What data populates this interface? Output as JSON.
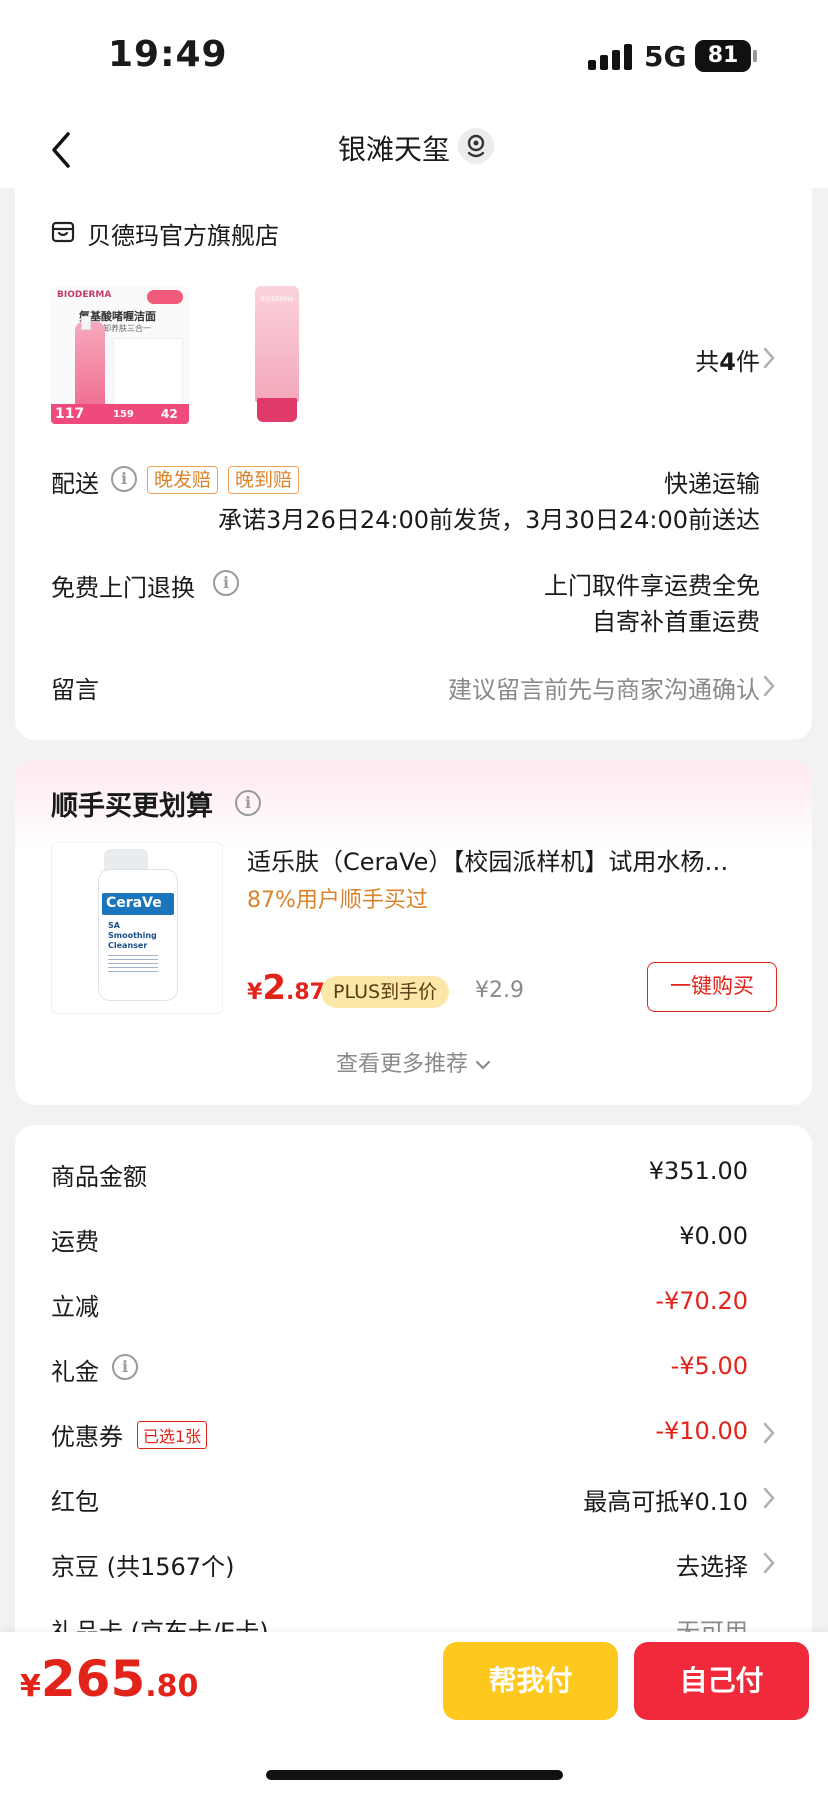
{
  "status_bar": {
    "time": "19:49",
    "network": "5G",
    "battery": "81"
  },
  "nav": {
    "title": "银滩天玺"
  },
  "store": {
    "name": "贝德玛官方旗舰店",
    "item_count_prefix": "共",
    "item_count": "4",
    "item_count_suffix": "件",
    "thumb1_brand": "BIODERMA",
    "thumb1_title": "氨基酸啫喱洁面",
    "thumb1_sub": "温和净卸养肤三合一",
    "thumb1_price": "117",
    "thumb1_price2": "159",
    "thumb1_price3": "42",
    "thumb2_brand": "BIODERMA"
  },
  "delivery": {
    "label": "配送",
    "tags": [
      "晚发赔",
      "晚到赔"
    ],
    "method": "快递运输",
    "promise": "承诺3月26日24:00前发货，3月30日24:00前送达"
  },
  "returns": {
    "label": "免费上门退换",
    "line1": "上门取件享运费全免",
    "line2": "自寄补首重运费"
  },
  "message": {
    "label": "留言",
    "placeholder": "建议留言前先与商家沟通确认"
  },
  "recommend": {
    "title": "顺手买更划算",
    "product_title": "适乐肤（CeraVe）【校园派样机】试用水杨…",
    "social_proof": "87%用户顺手买过",
    "price_symbol": "¥",
    "price_int": "2",
    "price_dec": ".87",
    "plus_label": "PLUS到手价",
    "orig_price": "¥2.9",
    "buy_button": "一键购买",
    "more_label": "查看更多推荐",
    "bottle_brand": "CeraVe",
    "bottle_line1": "SA",
    "bottle_line2": "Smoothing",
    "bottle_line3": "Cleanser"
  },
  "summary": {
    "rows": [
      {
        "label": "商品金额",
        "value": "¥351.00"
      },
      {
        "label": "运费",
        "value": "¥0.00"
      },
      {
        "label": "立减",
        "value": "-¥70.20"
      },
      {
        "label": "礼金",
        "value": "-¥5.00"
      },
      {
        "label": "优惠券",
        "tag": "已选1张",
        "value": "-¥10.00"
      },
      {
        "label": "红包",
        "value": "最高可抵¥0.10"
      },
      {
        "label": "京豆 (共1567个)",
        "value": "去选择"
      },
      {
        "label": "礼品卡 (京东卡/E卡)",
        "value": "无可用"
      }
    ]
  },
  "footer": {
    "currency": "¥",
    "total_int": "265",
    "total_dec": ".80",
    "help_pay": "帮我付",
    "self_pay": "自己付"
  },
  "colors": {
    "accent_red": "#e2231a",
    "yellow": "#ffc81f",
    "pay_red": "#f0293b"
  }
}
